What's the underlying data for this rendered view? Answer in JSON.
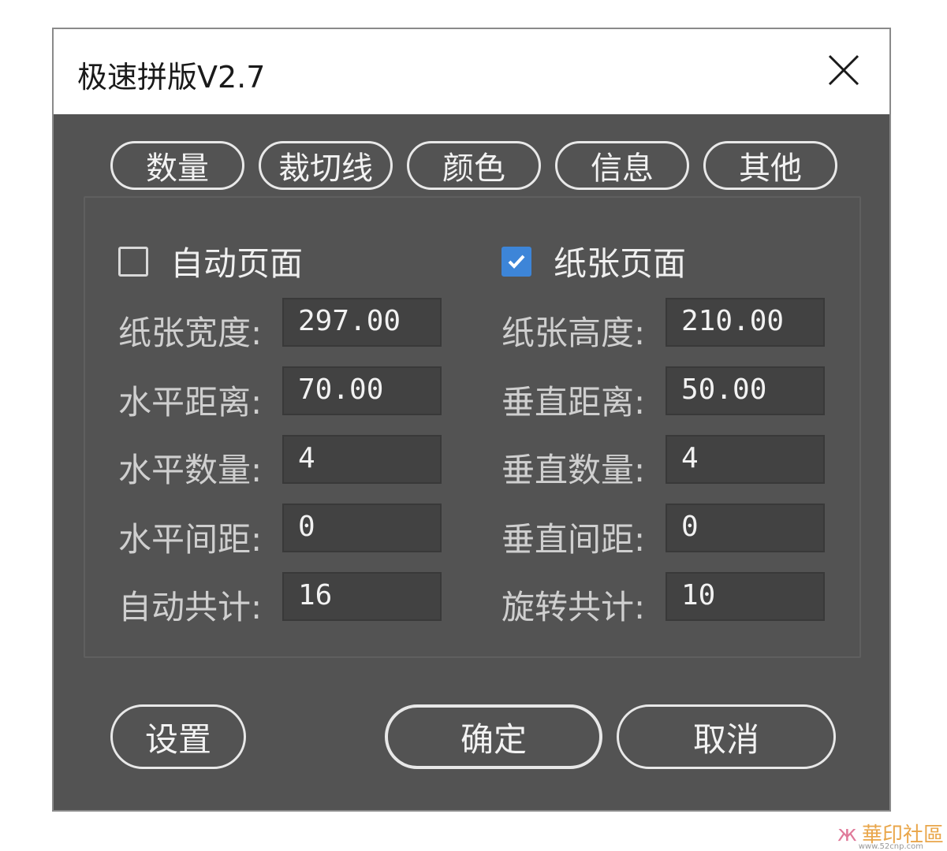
{
  "window": {
    "title": "极速拼版V2.7"
  },
  "tabs": [
    "数量",
    "裁切线",
    "颜色",
    "信息",
    "其他"
  ],
  "checkboxes": {
    "auto_page": {
      "label": "自动页面",
      "checked": false
    },
    "paper_page": {
      "label": "纸张页面",
      "checked": true
    }
  },
  "fields": {
    "paper_width": {
      "label": "纸张宽度:",
      "value": "297.00"
    },
    "paper_height": {
      "label": "纸张高度:",
      "value": "210.00"
    },
    "h_distance": {
      "label": "水平距离:",
      "value": "70.00"
    },
    "v_distance": {
      "label": "垂直距离:",
      "value": "50.00"
    },
    "h_count": {
      "label": "水平数量:",
      "value": "4"
    },
    "v_count": {
      "label": "垂直数量:",
      "value": "4"
    },
    "h_spacing": {
      "label": "水平间距:",
      "value": "0"
    },
    "v_spacing": {
      "label": "垂直间距:",
      "value": "0"
    },
    "auto_total": {
      "label": "自动共计:",
      "value": "16"
    },
    "rotate_total": {
      "label": "旋转共计:",
      "value": "10"
    }
  },
  "buttons": {
    "settings": "设置",
    "ok": "确定",
    "cancel": "取消"
  },
  "watermark": {
    "text": "華印社區",
    "url": "www.52cnp.com"
  },
  "colors": {
    "dialog_bg": "#535353",
    "accent": "#3d85d8",
    "input_bg": "#424242"
  }
}
